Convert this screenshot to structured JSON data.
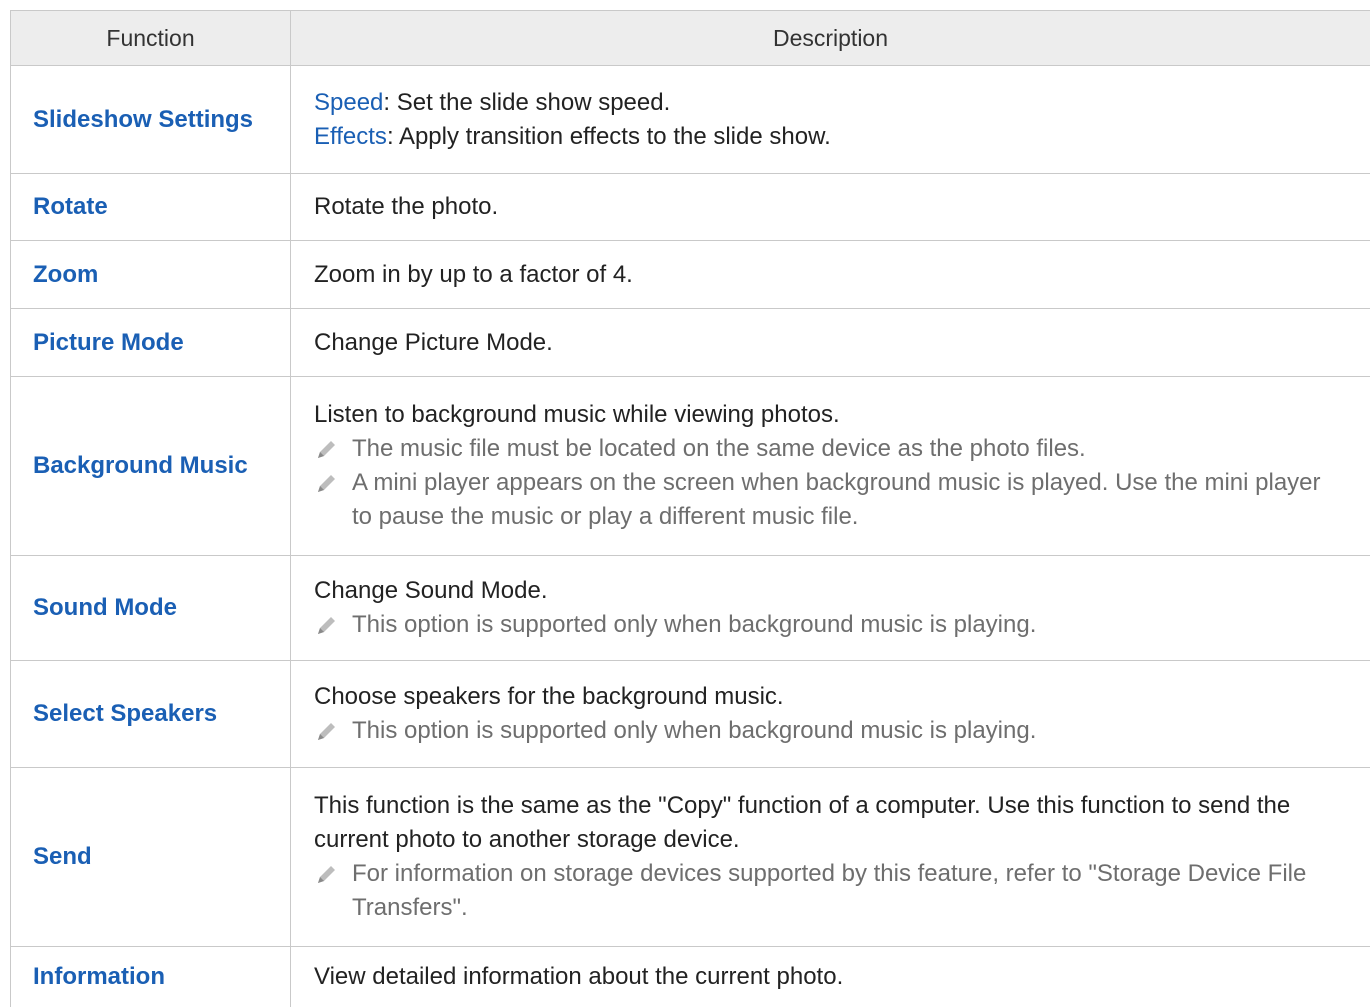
{
  "header": {
    "col1": "Function",
    "col2": "Description"
  },
  "rows": [
    {
      "function": "Slideshow Settings",
      "lines": [
        {
          "kw": "Speed",
          "text": ": Set the slide show speed."
        },
        {
          "kw": "Effects",
          "text": ": Apply transition effects to the slide show."
        }
      ]
    },
    {
      "function": "Rotate",
      "text": "Rotate the photo."
    },
    {
      "function": "Zoom",
      "text": "Zoom in by up to a factor of 4."
    },
    {
      "function": "Picture Mode",
      "text": "Change Picture Mode."
    },
    {
      "function": "Background Music",
      "text": "Listen to background music while viewing photos.",
      "notes": [
        "The music file must be located on the same device as the photo files.",
        "A mini player appears on the screen when background music is played. Use the mini player to pause the music or play a different music file."
      ]
    },
    {
      "function": "Sound Mode",
      "text": "Change Sound Mode.",
      "notes": [
        "This option is supported only when background music is playing."
      ]
    },
    {
      "function": "Select Speakers",
      "text": "Choose speakers for the background music.",
      "notes": [
        "This option is supported only when background music is playing."
      ]
    },
    {
      "function": "Send",
      "text": "This function is the same as the \"Copy\" function of a computer. Use this function to send the current photo to another storage device.",
      "notes": [
        "For information on storage devices supported by this feature, refer to \"Storage Device File Transfers\"."
      ]
    },
    {
      "function": "Information",
      "text": "View detailed information about the current photo."
    }
  ],
  "icons": {
    "note": "pencil-note-icon"
  },
  "colors": {
    "accent": "#1a5fb4",
    "header_bg": "#ededed",
    "note_text": "#6e6e6e"
  }
}
